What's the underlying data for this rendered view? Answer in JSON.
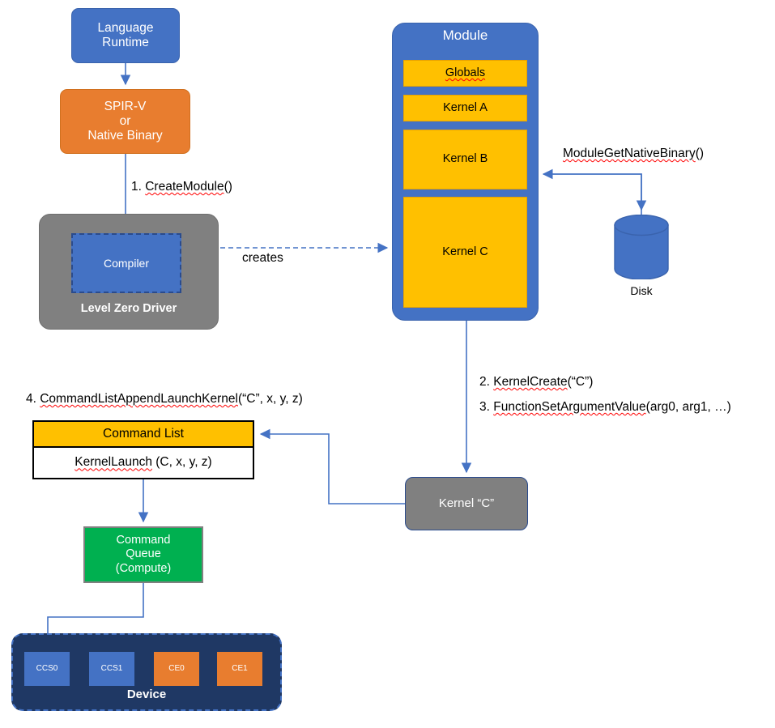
{
  "diagram": {
    "title": "Level Zero module / kernel execution flow",
    "colors": {
      "blue": "#4472C4",
      "orange": "#E87D2F",
      "gold": "#FFC000",
      "gray": "#808080",
      "green": "#00B050",
      "navy": "#1F3864",
      "connector": "#4472C4",
      "black": "#000000",
      "white": "#FFFFFF"
    }
  },
  "nodes": {
    "language_runtime": "Language\nRuntime",
    "language_runtime_line1": "Language",
    "language_runtime_line2": "Runtime",
    "spirv_line1": "SPIR-V",
    "spirv_line2": "or",
    "spirv_line3": "Native Binary",
    "driver_label": "Level Zero Driver",
    "compiler": "Compiler",
    "module_title": "Module",
    "module_slots": [
      {
        "label": "Globals",
        "squiggle": true
      },
      {
        "label": "Kernel A",
        "squiggle": false
      },
      {
        "label": "Kernel B",
        "squiggle": false
      },
      {
        "label": "Kernel C",
        "squiggle": false
      }
    ],
    "disk_label": "Disk",
    "command_list_header": "Command List",
    "command_list_entry_fn": "KernelLaunch",
    "command_list_entry_args": " (C, x, y, z)",
    "command_queue_line1": "Command",
    "command_queue_line2": "Queue",
    "command_queue_line3": "(Compute)",
    "kernel_c_node": "Kernel “C”",
    "device_label": "Device",
    "device_engines": [
      {
        "name": "CCS0",
        "kind": "compute"
      },
      {
        "name": "CCS1",
        "kind": "compute"
      },
      {
        "name": "CE0",
        "kind": "copy"
      },
      {
        "name": "CE1",
        "kind": "copy"
      }
    ]
  },
  "edge_labels": {
    "step1_num": "1. ",
    "step1_fn": "CreateModule",
    "step1_tail": "()",
    "creates": "creates",
    "module_get_native_binary_fn": "ModuleGetNativeBinary",
    "module_get_native_binary_tail": "()",
    "step2_num": "2. ",
    "step2_fn": "KernelCreate",
    "step2_tail": "(“C”)",
    "step3_num": "3. ",
    "step3_fn": "FunctionSetArgumentValue",
    "step3_tail": "(arg0, arg1, …)",
    "step4_num": "4. ",
    "step4_fn": "CommandListAppendLaunchKernel",
    "step4_tail": "(“C”, x, y, z)"
  }
}
